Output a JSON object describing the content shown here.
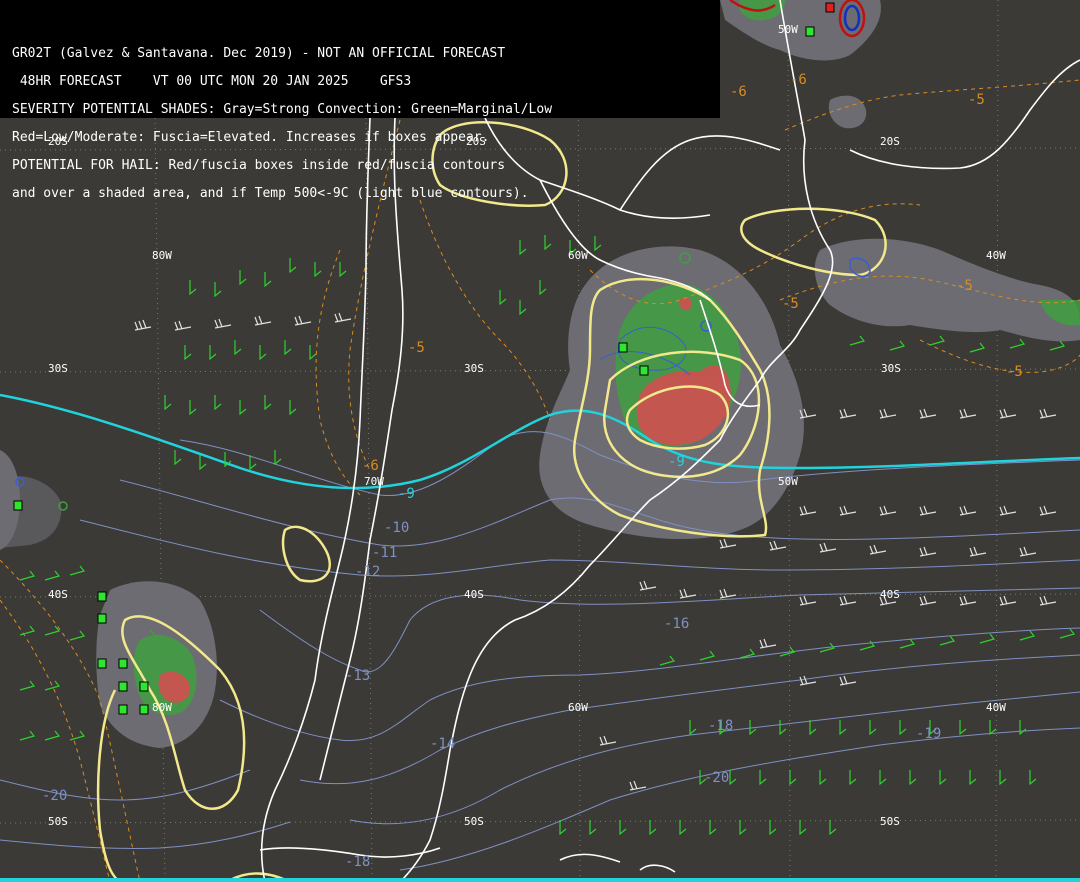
{
  "header": {
    "line1": "GR02T (Galvez & Santavana. Dec 2019) - NOT AN OFFICIAL FORECAST",
    "line2": " 48HR FORECAST    VT 00 UTC MON 20 JAN 2025    GFS3",
    "line3": "SEVERITY POTENTIAL SHADES: Gray=Strong Convection: Green=Marginal/Low",
    "line4": "Red=Low/Moderate: Fuscia=Elevated. Increases if boxes appear.",
    "line5": "POTENTIAL FOR HAIL: Red/fuscia boxes inside red/fuscia contours",
    "line6": "and over a shaded area, and if Temp 500<-9C (light blue contours)."
  },
  "grid_labels": {
    "lat_20s": "20S",
    "lat_30s": "30S",
    "lat_40s": "40S",
    "lat_50s": "50S",
    "lon_80w": "80W",
    "lon_70w": "70W",
    "lon_60w": "60W",
    "lon_50w": "50W",
    "lon_40w": "40W"
  },
  "temp_labels": {
    "m9_a": "-9",
    "m9_b": "-9",
    "m10": "-10",
    "m11": "-11",
    "m12": "-12",
    "m13": "-13",
    "m14": "-14",
    "m16": "-16",
    "m18": "-18",
    "m20": "-20",
    "m20b": "-20",
    "m18b": "-18",
    "m19": "-19",
    "m5a": "-5",
    "m5b": "-5",
    "m5c": "-5",
    "m5d": "-5",
    "m5e": "-5",
    "m6a": "-6",
    "m6b": "-6",
    "m6c": "-6"
  },
  "colors": {
    "background": "#3b3a36",
    "coastline": "#ffffff",
    "temp500_cold": "#21d3dc",
    "temp500_contour": "#7f90c4",
    "severity_yellow": "#f2e88c",
    "dashed_orange": "#d98c1f",
    "gray_shade": "#6f6f76",
    "green_shade": "#3f9f3f",
    "red_shade": "#d05050",
    "barb_green": "#2ed12e",
    "barb_white": "#e0e0e0",
    "hail_box": "#2ee62e"
  }
}
